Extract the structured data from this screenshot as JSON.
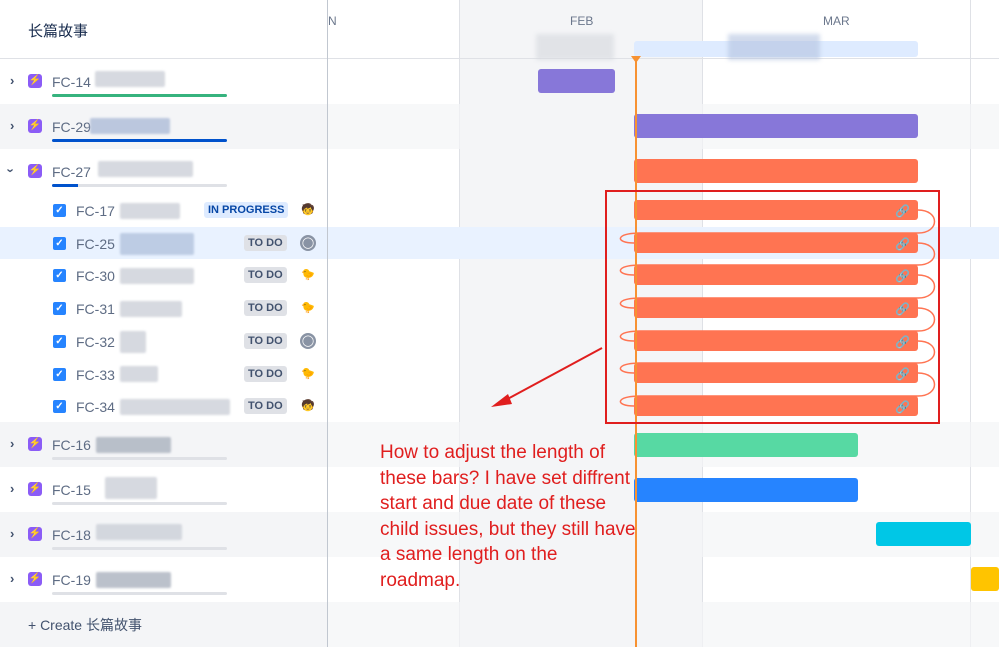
{
  "header": {
    "title": "长篇故事",
    "months": [
      "N",
      "FEB",
      "MAR"
    ]
  },
  "epics_top": [
    {
      "key": "FC-14",
      "progress_color": "#36B37E",
      "progress": 1.0
    },
    {
      "key": "FC-29",
      "progress_color": "#0052CC",
      "progress": 1.0
    },
    {
      "key": "FC-27",
      "progress_color": "#0052CC",
      "progress": 0.15
    }
  ],
  "children": [
    {
      "key": "FC-17",
      "status": "IN PROGRESS",
      "avatar": "🧒"
    },
    {
      "key": "FC-25",
      "status": "TO DO",
      "avatar": "◯"
    },
    {
      "key": "FC-30",
      "status": "TO DO",
      "avatar": "🐤"
    },
    {
      "key": "FC-31",
      "status": "TO DO",
      "avatar": "🐤"
    },
    {
      "key": "FC-32",
      "status": "TO DO",
      "avatar": "◯"
    },
    {
      "key": "FC-33",
      "status": "TO DO",
      "avatar": "🐤"
    },
    {
      "key": "FC-34",
      "status": "TO DO",
      "avatar": "🧒"
    }
  ],
  "epics_bottom": [
    {
      "key": "FC-16"
    },
    {
      "key": "FC-15"
    },
    {
      "key": "FC-18"
    },
    {
      "key": "FC-19"
    }
  ],
  "create_label": "+ Create 长篇故事",
  "annotation": "How to adjust the length of these bars? I have set diffrent start and due date of these child issues, but they still have a same length on the roadmap.",
  "colors": {
    "purple_bar": "#8777D9",
    "orange_bar": "#FF7452",
    "green_bar": "#57D9A3",
    "blue_bar": "#2684FF",
    "cyan_bar": "#00C7E6",
    "yellow_bar": "#FFC400",
    "annotation_red": "#E01E1E"
  }
}
